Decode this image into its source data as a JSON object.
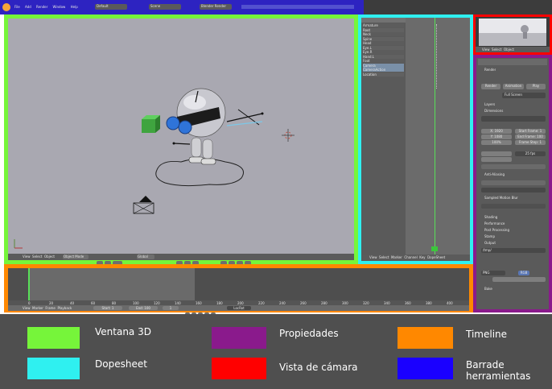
{
  "menubar": {
    "items": [
      "File",
      "Add",
      "Render",
      "Window",
      "Help"
    ],
    "layout": "Default",
    "scene": "Scene",
    "engine": "Blender Render"
  },
  "viewport": {
    "header_items": [
      "View",
      "Select",
      "Object",
      "Object Mode",
      "Global"
    ]
  },
  "dopesheet": {
    "channels": [
      "Armature",
      "Root",
      "Neck",
      "Spine",
      "Head",
      "Eye.L",
      "Eye.R",
      "Hand.L",
      "Foot",
      "Camera",
      "CameraAction",
      "Location"
    ],
    "header_items": [
      "View",
      "Select",
      "Marker",
      "Channel",
      "Key",
      "DopeSheet"
    ]
  },
  "camera_view": {
    "header_items": [
      "View",
      "Select",
      "Object"
    ]
  },
  "properties": {
    "sections": [
      "Render",
      "Layers",
      "Dimensions",
      "Anti-Aliasing",
      "Sampled Motion Blur",
      "Shading",
      "Performance",
      "Post Processing",
      "Stamp",
      "Output",
      "Bake"
    ],
    "render_buttons": [
      "Render",
      "Animation",
      "Play"
    ],
    "display": "Full Screen",
    "resolution_x": "X: 1920",
    "resolution_y": "Y: 1080",
    "resolution_pct": "100%",
    "start_frame": "Start Frame: 1",
    "end_frame": "End Frame: 100",
    "frame_step": "Frame Step: 1",
    "fps": "25 fps",
    "format": "PNG",
    "color_mode": "RGB",
    "output_path": "/tmp/"
  },
  "timeline": {
    "header_items": [
      "View",
      "Marker",
      "Frame",
      "Playback"
    ],
    "start": "Start: 1",
    "end": "End: 100",
    "current": "1",
    "keying": "LocRot",
    "ticks": [
      "0",
      "20",
      "40",
      "60",
      "80",
      "100",
      "120",
      "140",
      "160",
      "180",
      "200",
      "220",
      "240",
      "260",
      "280",
      "300",
      "320",
      "340",
      "360",
      "380",
      "400"
    ]
  },
  "legend": [
    {
      "label": "Ventana 3D",
      "color": "#76f53a"
    },
    {
      "label": "Dopesheet",
      "color": "#2ff0f0"
    },
    {
      "label": "Propiedades",
      "color": "#8a1a8c"
    },
    {
      "label": "Vista de cámara",
      "color": "#ff0000"
    },
    {
      "label": "Timeline",
      "color": "#ff8800"
    },
    {
      "label": "Barrade herramientas",
      "color": "#1a00ff"
    }
  ],
  "colors": {
    "viewport_bg": "#a9a8b1",
    "ui_dark": "#4b4b4b",
    "legend_bg": "#4f4f4f"
  }
}
